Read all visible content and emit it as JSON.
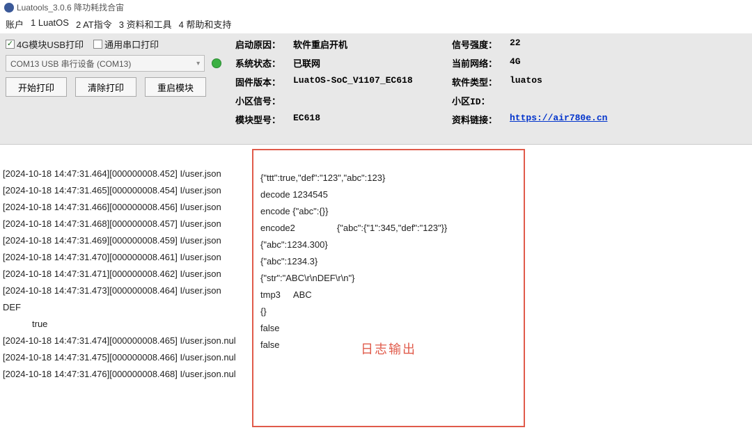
{
  "window": {
    "title": "Luatools_3.0.6 降功耗找合宙"
  },
  "menu": {
    "m1": "账户",
    "m2": "1 LuatOS",
    "m3": "2 AT指令",
    "m4": "3 资料和工具",
    "m5": "4 帮助和支持"
  },
  "toolbar": {
    "chk1_label": "4G模块USB打印",
    "chk2_label": "通用串口打印",
    "combo_text": "COM13 USB 串行设备 (COM13)",
    "btn_start": "开始打印",
    "btn_clear": "清除打印",
    "btn_reboot": "重启模块"
  },
  "info": {
    "reason_l": "启动原因：",
    "reason_v": "软件重启开机",
    "signal_l": "信号强度：",
    "signal_v": "22",
    "sysstate_l": "系统状态：",
    "sysstate_v": "已联网",
    "net_l": "当前网络：",
    "net_v": "4G",
    "fw_l": "固件版本：",
    "fw_v": "LuatOS-SoC_V1107_EC618",
    "swtype_l": "软件类型：",
    "swtype_v": "luatos",
    "cellsig_l": "小区信号：",
    "cellsig_v": "",
    "cellid_l": "小区ID：",
    "cellid_v": "",
    "model_l": "模块型号：",
    "model_v": "EC618",
    "doc_l": "资料链接：",
    "doc_v": "https://air780e.cn"
  },
  "log_left": {
    "l1": "[2024-10-18 14:47:31.464][000000008.452] I/user.json",
    "l2": "[2024-10-18 14:47:31.465][000000008.454] I/user.json",
    "l3": "[2024-10-18 14:47:31.466][000000008.456] I/user.json",
    "l4": "[2024-10-18 14:47:31.468][000000008.457] I/user.json",
    "l5": "[2024-10-18 14:47:31.469][000000008.459] I/user.json",
    "l6": "[2024-10-18 14:47:31.470][000000008.461] I/user.json",
    "l7": "[2024-10-18 14:47:31.471][000000008.462] I/user.json",
    "l8": "[2024-10-18 14:47:31.473][000000008.464] I/user.json",
    "l9": "DEF",
    "l10": "true",
    "l11": "[2024-10-18 14:47:31.474][000000008.465] I/user.json.nul",
    "l12": "[2024-10-18 14:47:31.475][000000008.466] I/user.json.nul",
    "l13": "[2024-10-18 14:47:31.476][000000008.468] I/user.json.nul"
  },
  "log_right": {
    "r1": "{\"ttt\":true,\"def\":\"123\",\"abc\":123}",
    "r2": "decode 1234545",
    "r3": "encode {\"abc\":{}}",
    "r4a": "encode2",
    "r4b": "{\"abc\":{\"1\":345,\"def\":\"123\"}}",
    "r5": "{\"abc\":1234.300}",
    "r6": "{\"abc\":1234.3}",
    "r7": "{\"str\":\"ABC\\r\\nDEF\\r\\n\"}",
    "r8a": "tmp3",
    "r8b": "ABC",
    "r9": "",
    "r10": "",
    "r11": "{}",
    "r12": "false",
    "r13": "false",
    "label": "日志输出"
  }
}
